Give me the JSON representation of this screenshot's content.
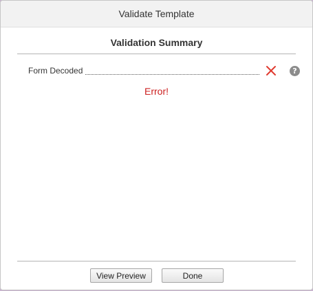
{
  "dialog": {
    "title": "Validate Template"
  },
  "summary": {
    "heading": "Validation Summary",
    "items": [
      {
        "label": "Form Decoded",
        "status_icon": "x-icon",
        "status_color": "#e03a2f",
        "help_icon": "help-icon",
        "help_glyph": "?"
      }
    ],
    "result_text": "Error!",
    "result_color": "#cc1f1f"
  },
  "footer": {
    "preview_label": "View Preview",
    "done_label": "Done"
  }
}
